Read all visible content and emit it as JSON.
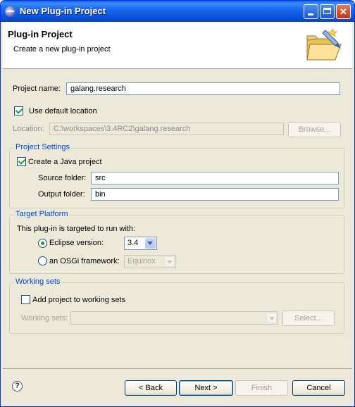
{
  "window": {
    "title": "New Plug-in Project"
  },
  "header": {
    "title": "Plug-in Project",
    "description": "Create a new plug-in project"
  },
  "project_name": {
    "label": "Project name:",
    "value": "galang.research"
  },
  "use_default_location": {
    "label": "Use default location",
    "checked": true
  },
  "location": {
    "label": "Location:",
    "value": "C:\\workspaces\\3.4RC2\\galang.research",
    "browse_label": "Browse..."
  },
  "project_settings": {
    "legend": "Project Settings",
    "create_java_project": {
      "label": "Create a Java project",
      "checked": true
    },
    "source_folder": {
      "label": "Source folder:",
      "value": "src"
    },
    "output_folder": {
      "label": "Output folder:",
      "value": "bin"
    }
  },
  "target_platform": {
    "legend": "Target Platform",
    "description": "This plug-in is targeted to run with:",
    "eclipse_version": {
      "label": "Eclipse version:",
      "value": "3.4",
      "selected": true
    },
    "osgi_framework": {
      "label": "an OSGi framework:",
      "value": "Equinox",
      "selected": false
    }
  },
  "working_sets": {
    "legend": "Working sets",
    "add_project": {
      "label": "Add project to working sets",
      "checked": false
    },
    "working_sets_label": "Working sets:",
    "working_sets_value": "",
    "select_label": "Select..."
  },
  "footer": {
    "back": "< Back",
    "next": "Next >",
    "finish": "Finish",
    "cancel": "Cancel",
    "help_glyph": "?"
  },
  "colors": {
    "titlebar": "#0b56e3",
    "dialog_bg": "#ece9d8",
    "group_legend": "#0046d5",
    "check_green": "#21a121"
  }
}
